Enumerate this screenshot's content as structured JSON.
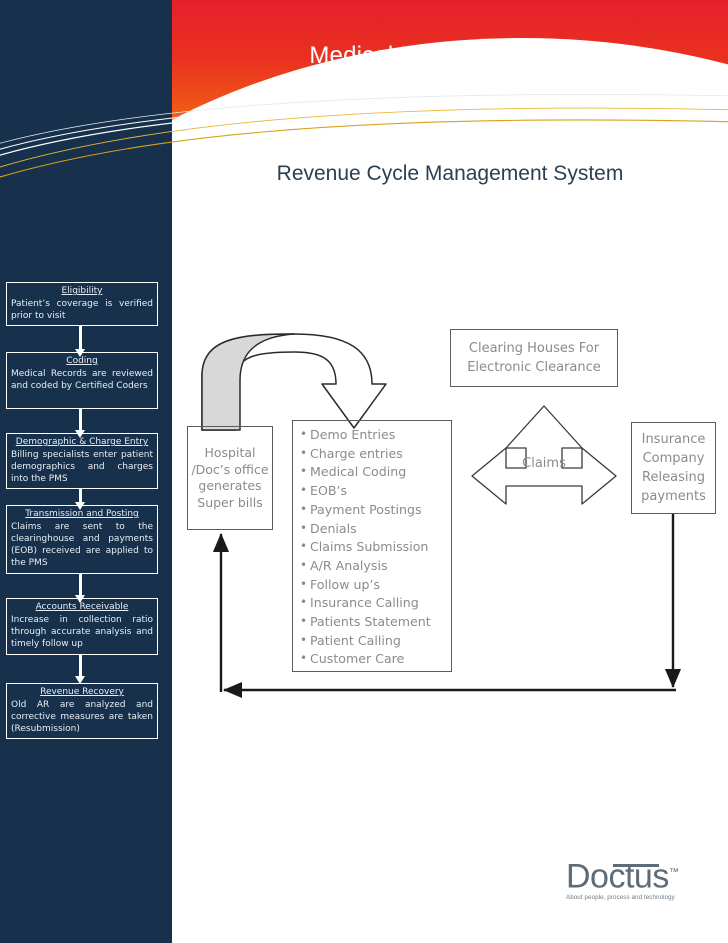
{
  "header": {
    "title": "Medical Billing Flow Chart",
    "subtitle": "Revenue Cycle Management System",
    "gradient_top": "#e5202c",
    "gradient_bottom": "#f4771a",
    "rail_color": "#17314c"
  },
  "sidebar": {
    "steps": [
      {
        "title": "Eligibility",
        "body": "Patient’s coverage is verified prior to visit"
      },
      {
        "title": "Coding",
        "body": "Medical Records are reviewed and coded by Certified Coders"
      },
      {
        "title": "Demographic & Charge Entry",
        "body": "Billing specialists enter patient demographics and charges into the PMS"
      },
      {
        "title": "Transmission and Posting",
        "body": "Claims are sent to the clearinghouse and payments (EOB) received are applied to the PMS"
      },
      {
        "title": "Accounts Receivable",
        "body": "Increase in collection ratio through accurate analysis and timely follow up"
      },
      {
        "title": "Revenue Recovery",
        "body": "Old AR are analyzed and corrective measures are taken (Resubmission)"
      }
    ]
  },
  "diagram": {
    "hospital": "Hospital /Doc’s office generates Super bills",
    "clearing_houses": "Clearing Houses For Electronic Clearance",
    "insurance": "Insurance Company Releasing payments",
    "claims_label": "Claims",
    "services": [
      "Demo Entries",
      "Charge entries",
      "Medical Coding",
      "EOB’s",
      "Payment Postings",
      "Denials",
      "Claims Submission",
      "A/R Analysis",
      "Follow up’s",
      "Insurance Calling",
      "Patients Statement",
      "Patient Calling",
      "Customer Care"
    ]
  },
  "logo": {
    "word": "Doctus",
    "tm": "™",
    "tagline": "About people, process and technology"
  }
}
